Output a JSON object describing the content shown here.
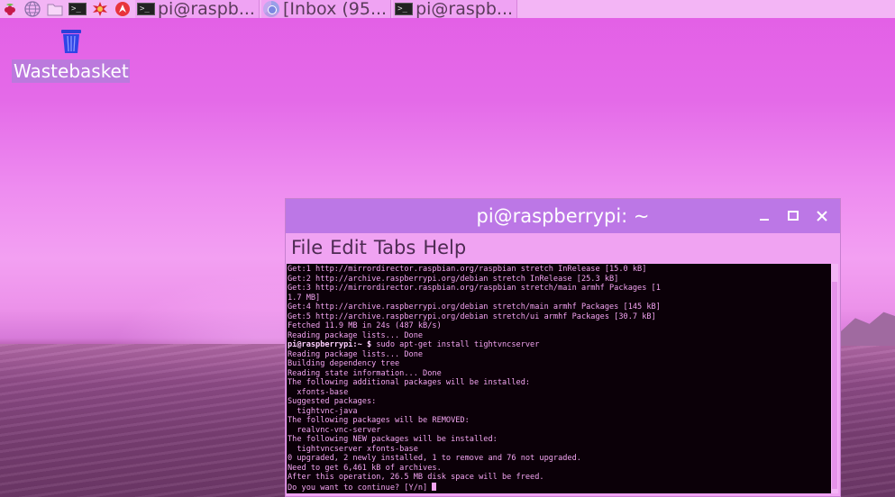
{
  "taskbar": {
    "launchers": [
      {
        "icon": "raspberry-menu-icon"
      },
      {
        "icon": "web-browser-icon"
      },
      {
        "icon": "file-manager-icon"
      },
      {
        "icon": "terminal-icon"
      },
      {
        "icon": "math-kernel-icon"
      },
      {
        "icon": "wolfram-icon"
      }
    ],
    "tasks": [
      {
        "label": "pi@raspb...",
        "icon": "terminal-icon"
      },
      {
        "label": "[Inbox (95...",
        "icon": "chromium-icon"
      },
      {
        "label": "pi@raspb...",
        "icon": "terminal-icon"
      }
    ]
  },
  "desktop": {
    "wastebasket_label": "Wastebasket"
  },
  "window": {
    "title": "pi@raspberrypi: ~",
    "menu": [
      "File",
      "Edit",
      "Tabs",
      "Help"
    ]
  },
  "terminal": {
    "lines": [
      "Get:1 http://mirrordirector.raspbian.org/raspbian stretch InRelease [15.0 kB]",
      "Get:2 http://archive.raspberrypi.org/debian stretch InRelease [25.3 kB]",
      "Get:3 http://mirrordirector.raspbian.org/raspbian stretch/main armhf Packages [1",
      "1.7 MB]",
      "Get:4 http://archive.raspberrypi.org/debian stretch/main armhf Packages [145 kB]",
      "Get:5 http://archive.raspberrypi.org/debian stretch/ui armhf Packages [30.7 kB]",
      "Fetched 11.9 MB in 24s (487 kB/s)",
      "Reading package lists... Done"
    ],
    "prompt": "pi@raspberrypi:~ $",
    "command": " sudo apt-get install tightvncserver",
    "output": [
      "Reading package lists... Done",
      "Building dependency tree",
      "Reading state information... Done",
      "The following additional packages will be installed:",
      "  xfonts-base",
      "Suggested packages:",
      "  tightvnc-java",
      "The following packages will be REMOVED:",
      "  realvnc-vnc-server",
      "The following NEW packages will be installed:",
      "  tightvncserver xfonts-base",
      "0 upgraded, 2 newly installed, 1 to remove and 76 not upgraded.",
      "Need to get 6,461 kB of archives.",
      "After this operation, 26.5 MB disk space will be freed."
    ],
    "question": "Do you want to continue? [Y/n] "
  }
}
